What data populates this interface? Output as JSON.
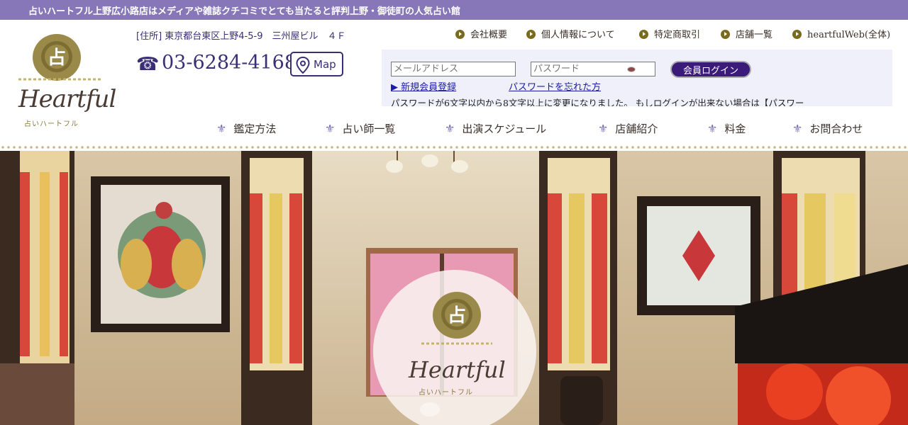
{
  "header": {
    "tagline": "占いハートフル上野広小路店はメディアや雑誌クチコミでとても当たると評判上野・御徒町の人気占い館",
    "logo_script": "Heartful",
    "logo_sub": "占いハートフル",
    "logo_badge": "占",
    "address": "[住所] 東京都台東区上野4-5-9　三州屋ビル　４Ｆ",
    "phone": "03-6284-4168",
    "map_label": "Map"
  },
  "toplinks": [
    {
      "label": "会社概要"
    },
    {
      "label": "個人情報について"
    },
    {
      "label": "特定商取引"
    },
    {
      "label": "店舗一覧"
    },
    {
      "label": "heartfulWeb(全体)"
    }
  ],
  "login": {
    "email_placeholder": "メールアドレス",
    "password_placeholder": "パスワード",
    "login_button": "会員ログイン",
    "register_link": "▶ 新規会員登録",
    "forgot_link": "パスワードを忘れた方",
    "notice": "パスワードが6文字以内から8文字以上に変更になりました。 もしログインが出来ない場合は【パスワー"
  },
  "nav": [
    {
      "label": "鑑定方法"
    },
    {
      "label": "占い師一覧"
    },
    {
      "label": "出演スケジュール"
    },
    {
      "label": "店舗紹介"
    },
    {
      "label": "料金"
    },
    {
      "label": "お問合わせ"
    }
  ],
  "hero": {
    "logo_script": "Heartful",
    "logo_sub": "占いハートフル",
    "logo_badge": "占"
  },
  "colors": {
    "brand_purple": "#8877b8",
    "navy": "#3a2f77",
    "gold": "#8a7a3a",
    "login_button": "#3b1b7a"
  }
}
